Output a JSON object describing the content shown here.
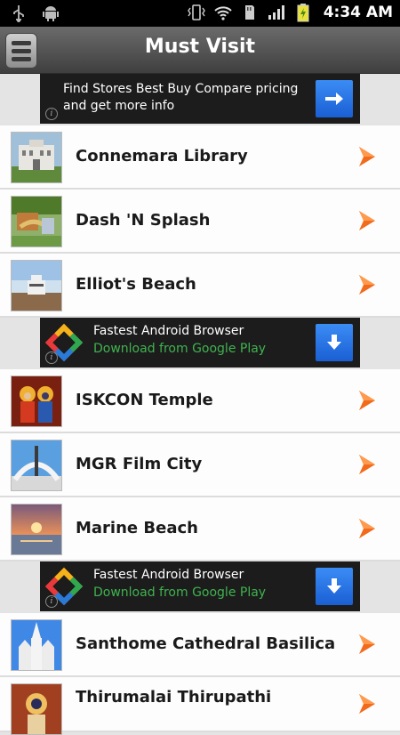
{
  "status_bar": {
    "time": "4:34 AM",
    "icons": [
      "usb-icon",
      "android-icon",
      "vibrate-icon",
      "wifi-icon",
      "sd-card-icon",
      "signal-icon",
      "battery-icon"
    ]
  },
  "title_bar": {
    "title": "Must Visit",
    "menu_icon": "menu-icon"
  },
  "ads": [
    {
      "text": "Find Stores Best Buy Compare pricing and get more info",
      "button_icon": "arrow-right-icon"
    },
    {
      "title": "Fastest Android Browser",
      "subtitle": "Download from Google Play",
      "button_icon": "download-icon"
    },
    {
      "title": "Fastest Android Browser",
      "subtitle": "Download from Google Play",
      "button_icon": "download-icon"
    }
  ],
  "places": [
    {
      "name": "Connemara Library"
    },
    {
      "name": "Dash 'N Splash"
    },
    {
      "name": "Elliot's Beach"
    },
    {
      "name": "ISKCON Temple"
    },
    {
      "name": "MGR Film City"
    },
    {
      "name": "Marine Beach"
    },
    {
      "name": "Santhome Cathedral Basilica"
    },
    {
      "name": "Thirumalai Thirupathi"
    }
  ],
  "colors": {
    "accent_arrow": "#f26a1b",
    "ad_subtitle": "#3fb34f",
    "ad_button": "#1a5fd4"
  }
}
